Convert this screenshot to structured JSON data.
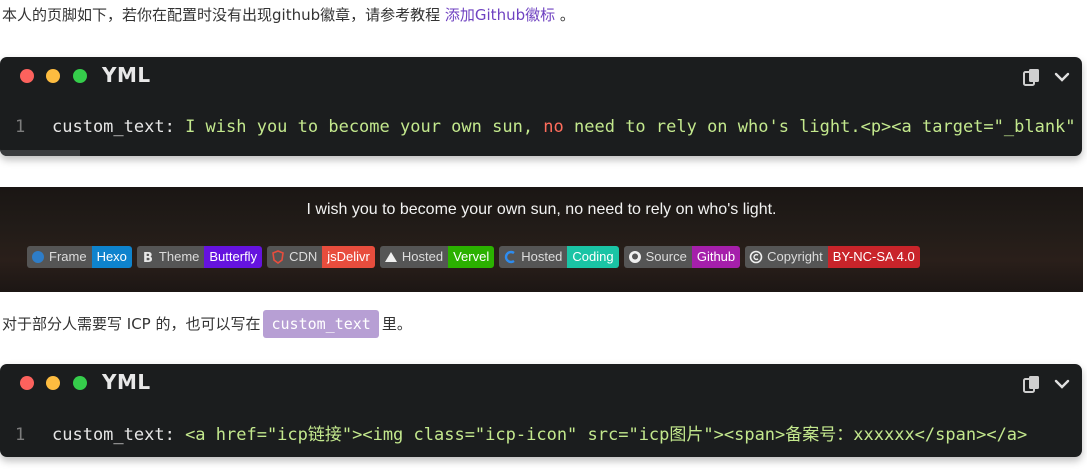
{
  "intro": {
    "text": "本人的页脚如下，若你在配置时没有出现github徽章，请参考教程 ",
    "link": "添加Github徽标",
    "tail": " 。"
  },
  "code1": {
    "lang": "YML",
    "line_number": "1",
    "key": "custom_text:",
    "str1": " I wish you to become your own sun, ",
    "kw": "no",
    "str2": " need to rely on who's light.<p><a target=\"_blank\" href=\"https://hexo.io/\"><img src=\"https://img.shields.io/badge/Frame-Hexo-blue?style=flat&logo=hexo\" title=\"博客框架为Hexo\"></a>"
  },
  "footer": {
    "text": "I wish you to become your own sun, no need to rely on who's light.",
    "badges": [
      {
        "left": "Frame",
        "right": "Hexo",
        "color": "#0e83cd",
        "icon": "hexo-icon"
      },
      {
        "left": "Theme",
        "right": "Butterfly",
        "color": "#6513df",
        "icon": "butterfly-icon"
      },
      {
        "left": "CDN",
        "right": "jsDelivr",
        "color": "#e84d3d",
        "icon": "jsdelivr-icon"
      },
      {
        "left": "Hosted",
        "right": "Vervel",
        "color": "#2bb100",
        "icon": "vercel-icon"
      },
      {
        "left": "Hosted",
        "right": "Coding",
        "color": "#1ac4a5",
        "icon": "coding-icon"
      },
      {
        "left": "Source",
        "right": "Github",
        "color": "#a51fab",
        "icon": "github-icon"
      },
      {
        "left": "Copyright",
        "right": "BY-NC-SA 4.0",
        "color": "#c9242a",
        "icon": "copyright-icon"
      }
    ]
  },
  "para2": {
    "text1": "对于部分人需要写 ICP 的，也可以写在",
    "code": "custom_text",
    "text2": "里。"
  },
  "code2": {
    "lang": "YML",
    "line_number": "1",
    "key": "custom_text:",
    "str": " <a href=\"icp链接\"><img class=\"icp-icon\" src=\"icp图片\"><span>备案号：xxxxxx</span></a>"
  }
}
